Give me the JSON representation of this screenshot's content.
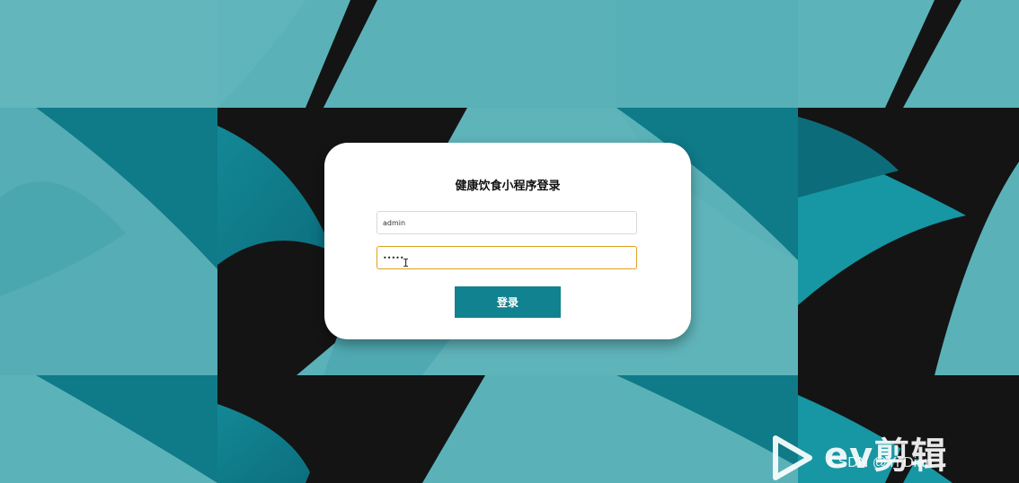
{
  "login": {
    "title": "健康饮食小程序登录",
    "username_value": "admin",
    "password_value": "•••••",
    "submit_label": "登录"
  },
  "watermark": {
    "logo_text": "ev剪辑",
    "csdn_text": "CSDN @Yi Dian"
  },
  "colors": {
    "background_teal": "#5ab2b8",
    "dark_teal": "#11828f",
    "black_shape": "#141414",
    "button": "#11828f",
    "focused_border": "#e0a020"
  },
  "icons": {
    "play_logo": "play-triangle-icon",
    "text_cursor": "i-beam-cursor-icon"
  }
}
